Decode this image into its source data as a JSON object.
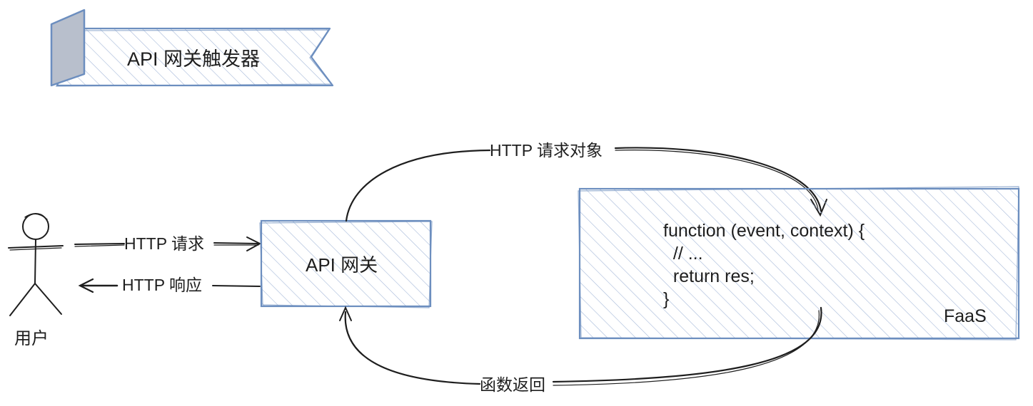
{
  "title_banner": {
    "text": "API 网关触发器"
  },
  "user": {
    "label": "用户"
  },
  "gateway": {
    "label": "API 网关"
  },
  "faas": {
    "label": "FaaS",
    "code_lines": [
      "function (event, context) {",
      "  // ...",
      "  return res;",
      "}"
    ]
  },
  "arrows": {
    "http_request": "HTTP 请求",
    "http_response": "HTTP 响应",
    "http_request_object": "HTTP 请求对象",
    "function_return": "函数返回"
  },
  "colors": {
    "box_stroke": "#6c8ebf",
    "hatch": "#a5b8d8",
    "flag_pole": "#b8bfcc",
    "ink": "#1e1e1e"
  }
}
